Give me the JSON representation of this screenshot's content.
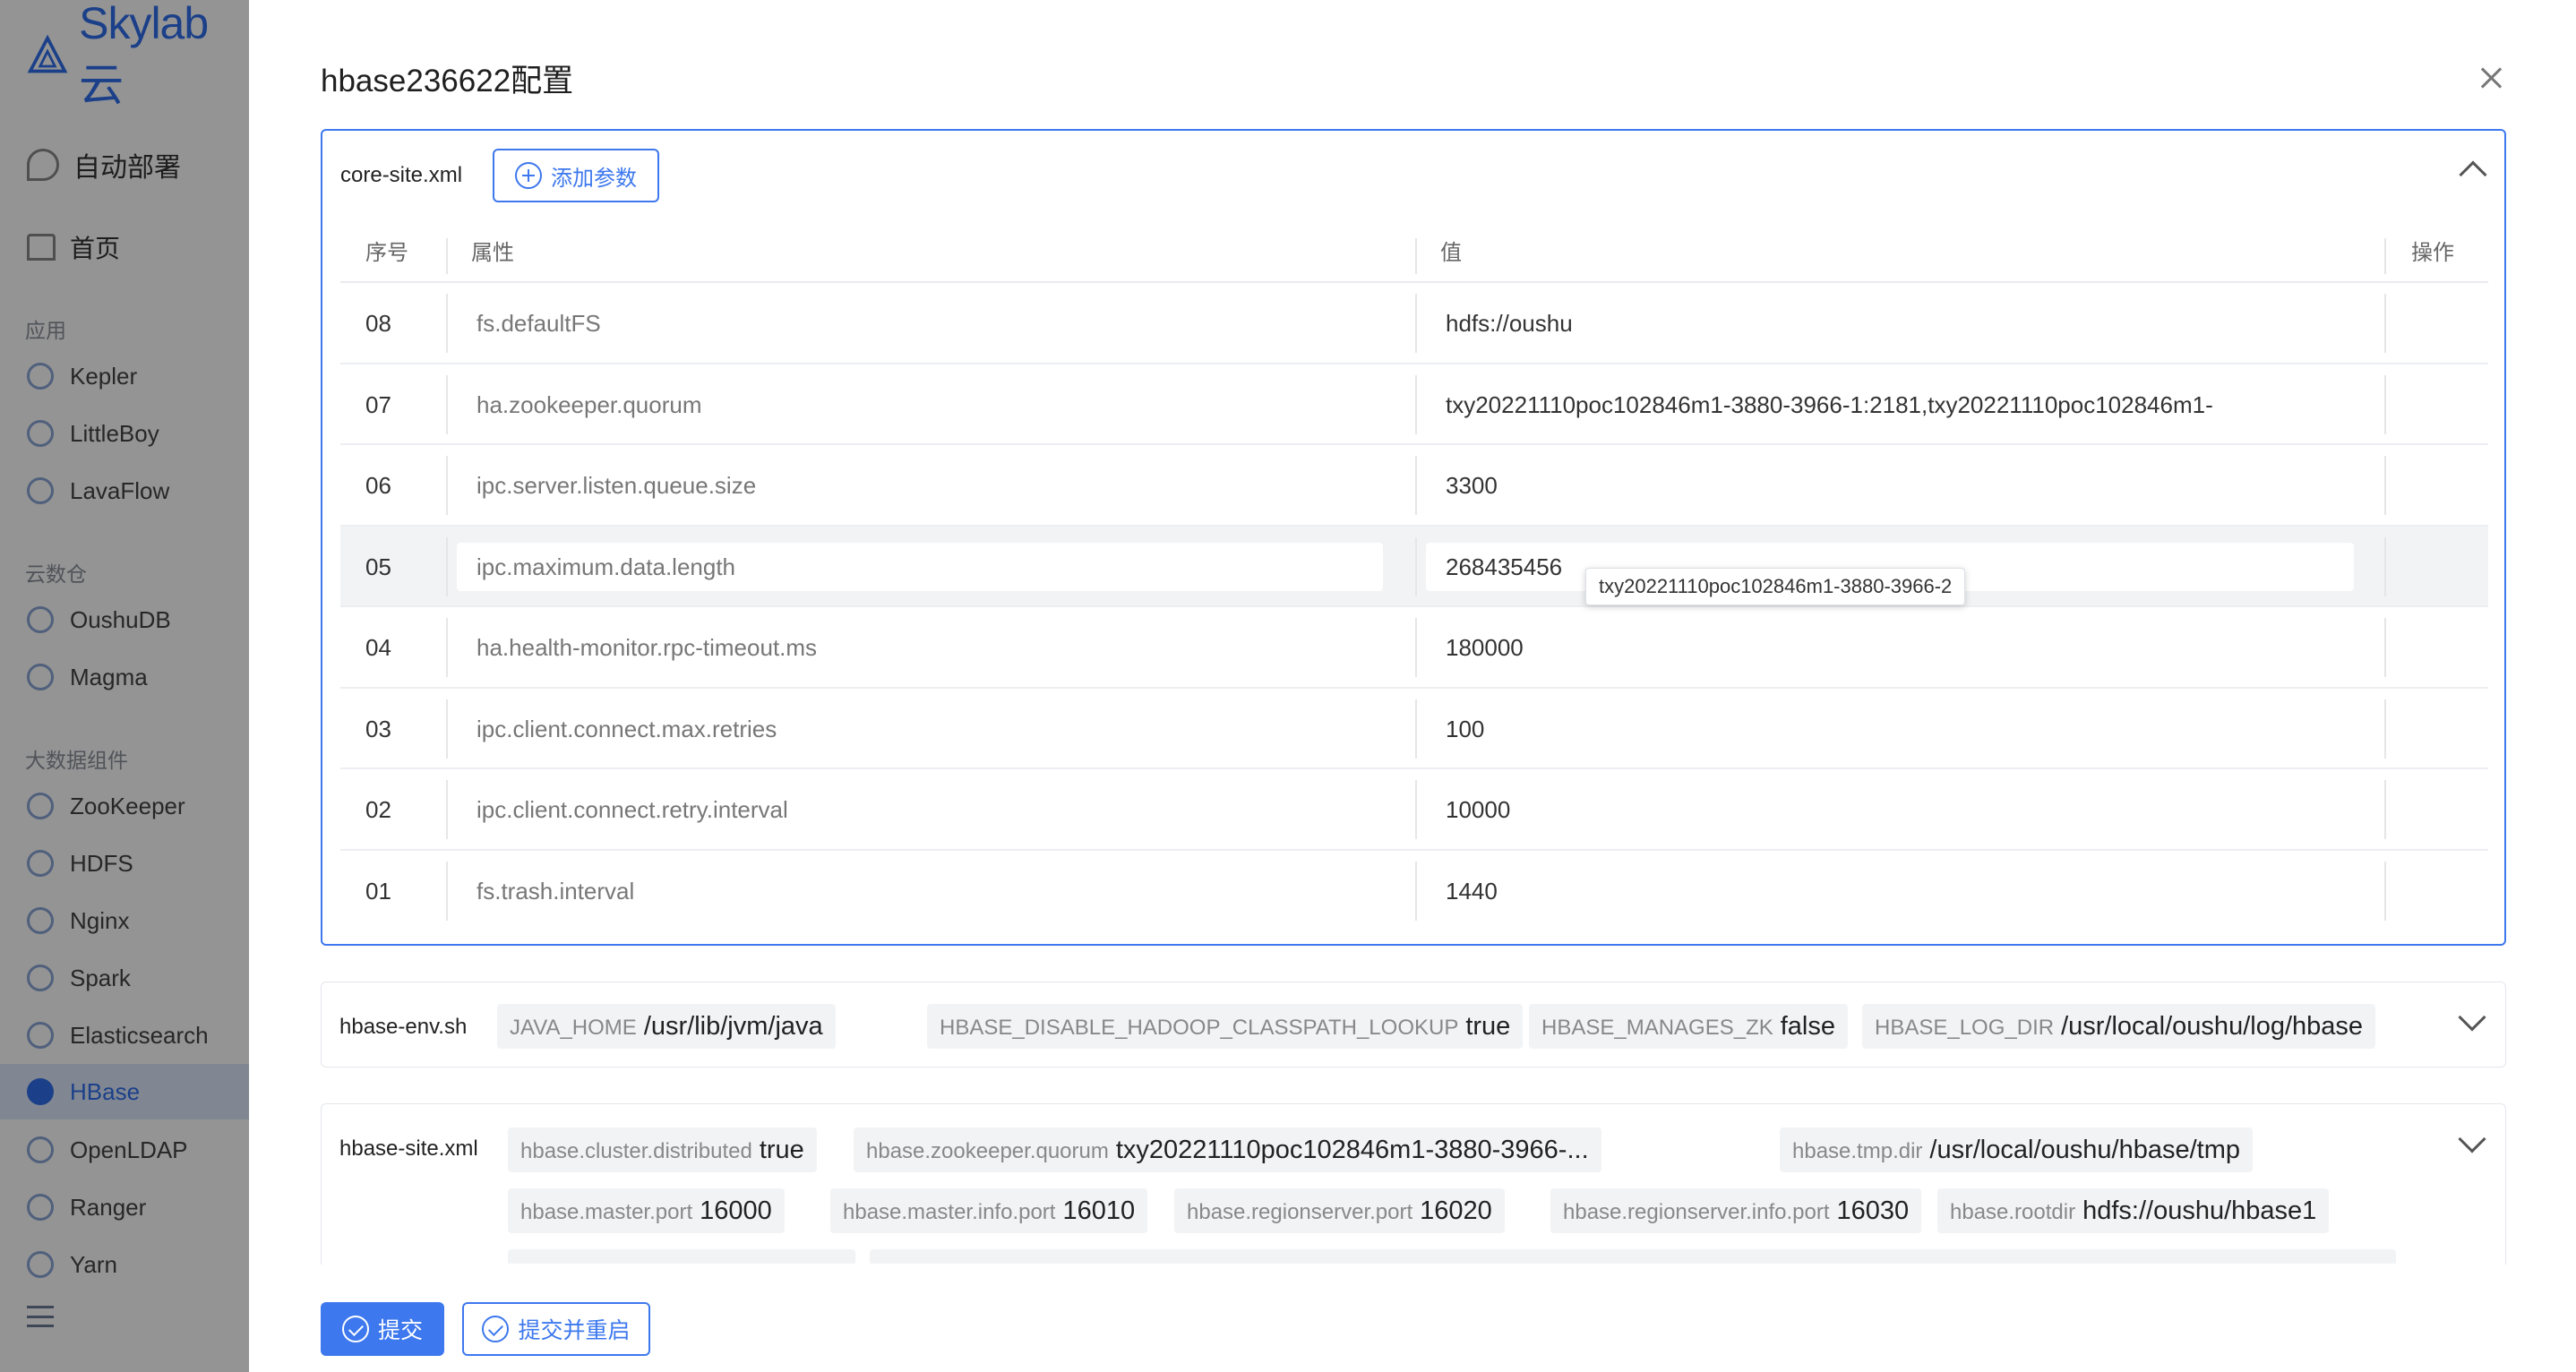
{
  "app": {
    "logo": "Skylab 云",
    "nav_top": "自动部署",
    "nav_home": "首页",
    "groups": [
      {
        "label": "应用",
        "items": [
          "Kepler",
          "LittleBoy",
          "LavaFlow"
        ]
      },
      {
        "label": "云数仓",
        "items": [
          "OushuDB",
          "Magma"
        ]
      },
      {
        "label": "大数据组件",
        "items": [
          "ZooKeeper",
          "HDFS",
          "Nginx",
          "Spark",
          "Elasticsearch",
          "HBase",
          "OpenLDAP",
          "Ranger",
          "Yarn"
        ]
      }
    ],
    "active_item": "HBase"
  },
  "drawer": {
    "title": "hbase236622配置",
    "core_site": {
      "label": "core-site.xml",
      "add_button": "添加参数",
      "columns": {
        "index": "序号",
        "property": "属性",
        "value": "值",
        "action": "操作"
      },
      "rows": [
        {
          "index": "08",
          "property": "fs.defaultFS",
          "value": "hdfs://oushu"
        },
        {
          "index": "07",
          "property": "ha.zookeeper.quorum",
          "value": "txy20221110poc102846m1-3880-3966-1:2181,txy20221110poc102846m1-"
        },
        {
          "index": "06",
          "property": "ipc.server.listen.queue.size",
          "value": "3300"
        },
        {
          "index": "05",
          "property": "ipc.maximum.data.length",
          "value": "268435456"
        },
        {
          "index": "04",
          "property": "ha.health-monitor.rpc-timeout.ms",
          "value": "180000"
        },
        {
          "index": "03",
          "property": "ipc.client.connect.max.retries",
          "value": "100"
        },
        {
          "index": "02",
          "property": "ipc.client.connect.retry.interval",
          "value": "10000"
        },
        {
          "index": "01",
          "property": "fs.trash.interval",
          "value": "1440"
        }
      ],
      "tooltip": "txy20221110poc102846m1-3880-3966-2"
    },
    "hbase_env": {
      "label": "hbase-env.sh",
      "tags": [
        {
          "key": "JAVA_HOME",
          "value": "/usr/lib/jvm/java"
        },
        {
          "key": "HBASE_DISABLE_HADOOP_CLASSPATH_LOOKUP",
          "value": "true"
        },
        {
          "key": "HBASE_MANAGES_ZK",
          "value": "false"
        },
        {
          "key": "HBASE_LOG_DIR",
          "value": "/usr/local/oushu/log/hbase"
        }
      ]
    },
    "hbase_site": {
      "label": "hbase-site.xml",
      "tags": [
        {
          "key": "hbase.cluster.distributed",
          "value": "true"
        },
        {
          "key": "hbase.zookeeper.quorum",
          "value": "txy20221110poc102846m1-3880-3966-..."
        },
        {
          "key": "hbase.tmp.dir",
          "value": "/usr/local/oushu/hbase/tmp"
        },
        {
          "key": "hbase.master.port",
          "value": "16000"
        },
        {
          "key": "hbase.master.info.port",
          "value": "16010"
        },
        {
          "key": "hbase.regionserver.port",
          "value": "16020"
        },
        {
          "key": "hbase.regionserver.info.port",
          "value": "16030"
        },
        {
          "key": "hbase.rootdir",
          "value": "hdfs://oushu/hbase1"
        }
      ]
    },
    "footer": {
      "submit": "提交",
      "submit_restart": "提交并重启"
    }
  },
  "colors": {
    "primary": "#3d78ee",
    "overlay": "rgba(0,0,0,0.42)"
  }
}
